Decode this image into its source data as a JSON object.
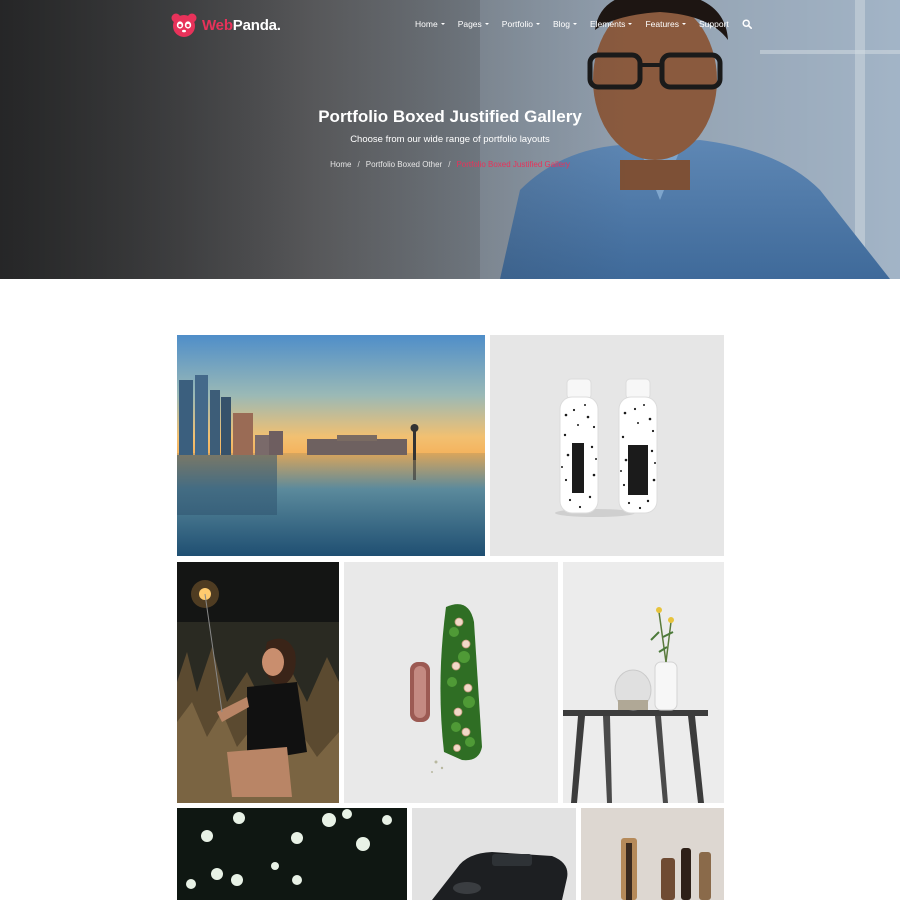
{
  "logo": {
    "part1": "Web",
    "part2": "Panda."
  },
  "nav": {
    "items": [
      {
        "label": "Home",
        "dropdown": true
      },
      {
        "label": "Pages",
        "dropdown": true
      },
      {
        "label": "Portfolio",
        "dropdown": true
      },
      {
        "label": "Blog",
        "dropdown": true
      },
      {
        "label": "Elements",
        "dropdown": true
      },
      {
        "label": "Features",
        "dropdown": true
      },
      {
        "label": "Support",
        "dropdown": false
      }
    ],
    "search_icon": "search-icon"
  },
  "hero": {
    "title": "Portfolio Boxed Justified Gallery",
    "subtitle": "Choose from our wide range of portfolio layouts"
  },
  "breadcrumb": {
    "home": "Home",
    "parent": "Portfolio Boxed Other",
    "current": "Portfolio Boxed Justified Gallery",
    "separator": "/"
  },
  "colors": {
    "accent": "#e8325a",
    "white": "#ffffff"
  }
}
